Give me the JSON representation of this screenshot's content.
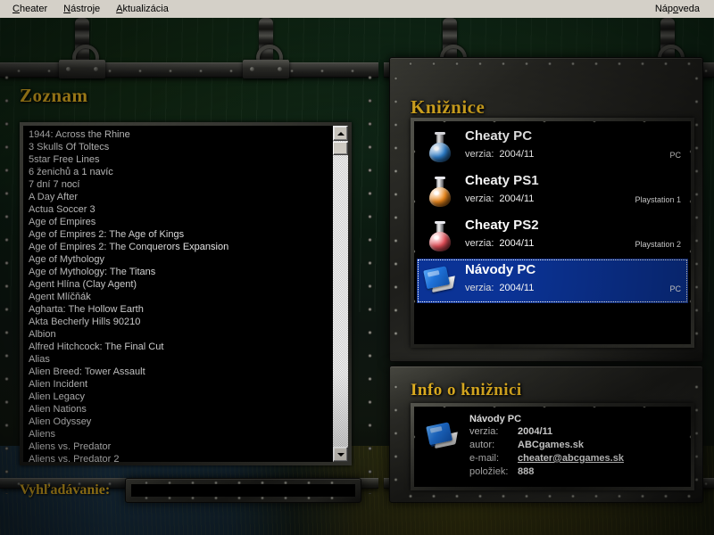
{
  "menu": {
    "items": [
      {
        "label": "Cheater",
        "accel": "C"
      },
      {
        "label": "Nástroje",
        "accel": "N"
      },
      {
        "label": "Aktualizácia",
        "accel": "A"
      }
    ],
    "help": {
      "label": "Nápoveda",
      "accel": "o"
    }
  },
  "colors": {
    "title_gold": "#e6b422",
    "selection_blue": "#0b3396",
    "panel_black": "#000000",
    "menubar": "#d4d0c8"
  },
  "list_panel": {
    "title": "Zoznam",
    "items": [
      "1944: Across the Rhine",
      "3 Skulls Of Toltecs",
      "5star Free Lines",
      "6 ženichů a 1 navíc",
      "7 dní 7 nocí",
      "A Day After",
      "Actua Soccer 3",
      "Age of Empires",
      "Age of Empires 2: The Age of Kings",
      "Age of Empires 2: The Conquerors Expansion",
      "Age of Mythology",
      "Age of Mythology: The Titans",
      "Agent Hlína (Clay Agent)",
      "Agent Mlíčňák",
      "Agharta: The Hollow Earth",
      "Akta Becherly Hills 90210",
      "Albion",
      "Alfred Hitchcock: The Final Cut",
      "Alias",
      "Alien Breed: Tower Assault",
      "Alien Incident",
      "Alien Legacy",
      "Alien Nations",
      "Alien Odyssey",
      "Aliens",
      "Aliens vs. Predator",
      "Aliens vs. Predator 2"
    ],
    "scrollbar": {
      "up_icon": "triangle-up-icon",
      "down_icon": "triangle-down-icon"
    }
  },
  "search": {
    "label": "Vyhľadávanie:",
    "value": "",
    "placeholder": ""
  },
  "libraries_panel": {
    "title": "Knižnice",
    "version_key": "verzia:",
    "items": [
      {
        "name": "Cheaty PC",
        "version": "2004/11",
        "platform": "PC",
        "icon": "flask-icon-blue",
        "icon_color": "#2f86d8",
        "selected": false
      },
      {
        "name": "Cheaty PS1",
        "version": "2004/11",
        "platform": "Playstation 1",
        "icon": "flask-icon-orange",
        "icon_color": "#f08a1c",
        "selected": false
      },
      {
        "name": "Cheaty PS2",
        "version": "2004/11",
        "platform": "Playstation 2",
        "icon": "flask-icon-red",
        "icon_color": "#e8505a",
        "selected": false
      },
      {
        "name": "Návody PC",
        "version": "2004/11",
        "platform": "PC",
        "icon": "book-icon-blue",
        "icon_color": "#1f72d8",
        "selected": true
      }
    ]
  },
  "info_panel": {
    "title": "Info o knižnici",
    "icon": "book-icon-blue",
    "name": "Návody PC",
    "fields": [
      {
        "key": "verzia:",
        "value": "2004/11",
        "link": false
      },
      {
        "key": "autor:",
        "value": "ABCgames.sk",
        "link": false
      },
      {
        "key": "e-mail:",
        "value": "cheater@abcgames.sk",
        "link": true
      },
      {
        "key": "položiek:",
        "value": "888",
        "link": false
      }
    ]
  }
}
